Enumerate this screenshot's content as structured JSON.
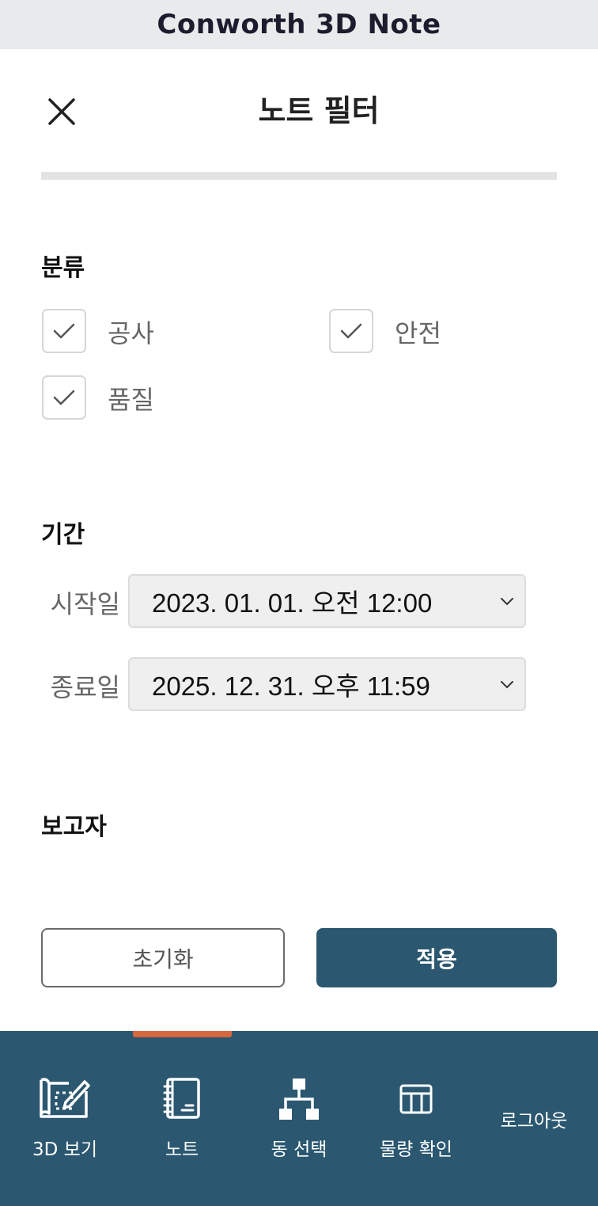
{
  "app_title": "Conworth 3D Note",
  "modal": {
    "title": "노트 필터"
  },
  "sections": {
    "category": {
      "label": "분류",
      "options": [
        {
          "label": "공사",
          "checked": true
        },
        {
          "label": "안전",
          "checked": true
        },
        {
          "label": "품질",
          "checked": true
        }
      ]
    },
    "period": {
      "label": "기간",
      "start_label": "시작일",
      "start_value": "2023. 01. 01. 오전 12:00",
      "end_label": "종료일",
      "end_value": "2025. 12. 31. 오후 11:59"
    },
    "reporter": {
      "label": "보고자"
    }
  },
  "actions": {
    "reset_label": "초기화",
    "apply_label": "적용"
  },
  "bottom_nav": {
    "items": [
      {
        "label": "3D 보기",
        "icon": "blueprint-edit-icon"
      },
      {
        "label": "노트",
        "icon": "notebook-icon"
      },
      {
        "label": "동 선택",
        "icon": "hierarchy-icon"
      },
      {
        "label": "물량 확인",
        "icon": "table-icon"
      }
    ],
    "logout_label": "로그아웃",
    "active_index": 1
  },
  "colors": {
    "primary": "#2b5870",
    "active_indicator": "#d8673f",
    "header_bg": "#e8ebec"
  }
}
